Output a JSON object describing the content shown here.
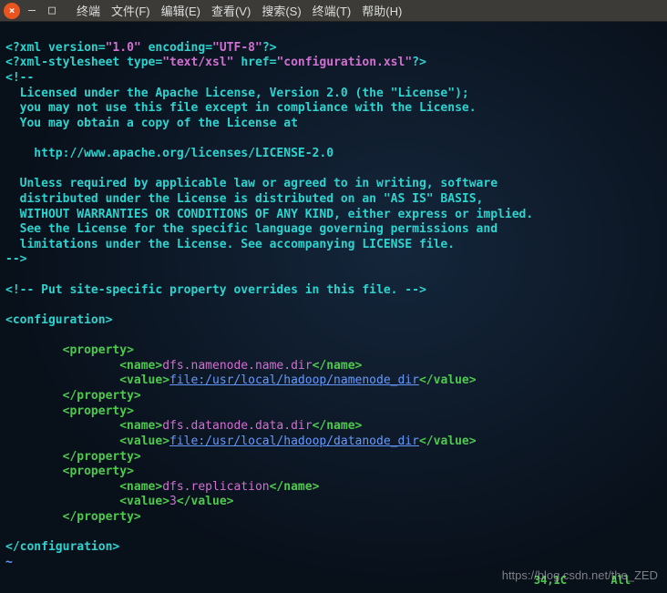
{
  "window": {
    "close": "×",
    "min": "—",
    "max": "□"
  },
  "menu": {
    "terminal": "终端",
    "file": "文件(F)",
    "edit": "编辑(E)",
    "view": "查看(V)",
    "search": "搜索(S)",
    "terminal2": "终端(T)",
    "help": "帮助(H)"
  },
  "xml": {
    "decl_open": "<?xml ",
    "version_attr": "version",
    "version_val": "\"1.0\"",
    "encoding_attr": "encoding",
    "encoding_val": "\"UTF-8\"",
    "decl_close": "?>",
    "stylesheet_open": "<?xml-stylesheet ",
    "type_attr": "type",
    "type_val": "\"text/xsl\"",
    "href_attr": "href",
    "href_val": "\"configuration.xsl\"",
    "stylesheet_close": "?>"
  },
  "license": {
    "open": "<!--",
    "l1": "  Licensed under the Apache License, Version 2.0 (the \"License\");",
    "l2": "  you may not use this file except in compliance with the License.",
    "l3": "  You may obtain a copy of the License at",
    "url": "    http://www.apache.org/licenses/LICENSE-2.0",
    "l4": "  Unless required by applicable law or agreed to in writing, software",
    "l5": "  distributed under the License is distributed on an \"AS IS\" BASIS,",
    "l6": "  WITHOUT WARRANTIES OR CONDITIONS OF ANY KIND, either express or implied.",
    "l7": "  See the License for the specific language governing permissions and",
    "l8": "  limitations under the License. See accompanying LICENSE file.",
    "close": "-->",
    "site_comment": "<!-- Put site-specific property overrides in this file. -->"
  },
  "config": {
    "open": "<configuration>",
    "close": "</configuration>",
    "prop_open": "<property>",
    "prop_close": "</property>",
    "name_open": "<name>",
    "name_close": "</name>",
    "value_open": "<value>",
    "value_close": "</value>",
    "p1_name": "dfs.namenode.name.dir",
    "p1_value": "file:/usr/local/hadoop/namenode_dir",
    "p2_name": "dfs.datanode.data.dir",
    "p2_value": "file:/usr/local/hadoop/datanode_dir",
    "p3_name": "dfs.replication",
    "p3_value": "3"
  },
  "status": {
    "pos": "34,1C",
    "mode": "All"
  },
  "tilde": "~",
  "eq": "=",
  "sp": " ",
  "indent1": "        ",
  "indent2": "                ",
  "watermark": "https://blog.csdn.net/the_ZED"
}
